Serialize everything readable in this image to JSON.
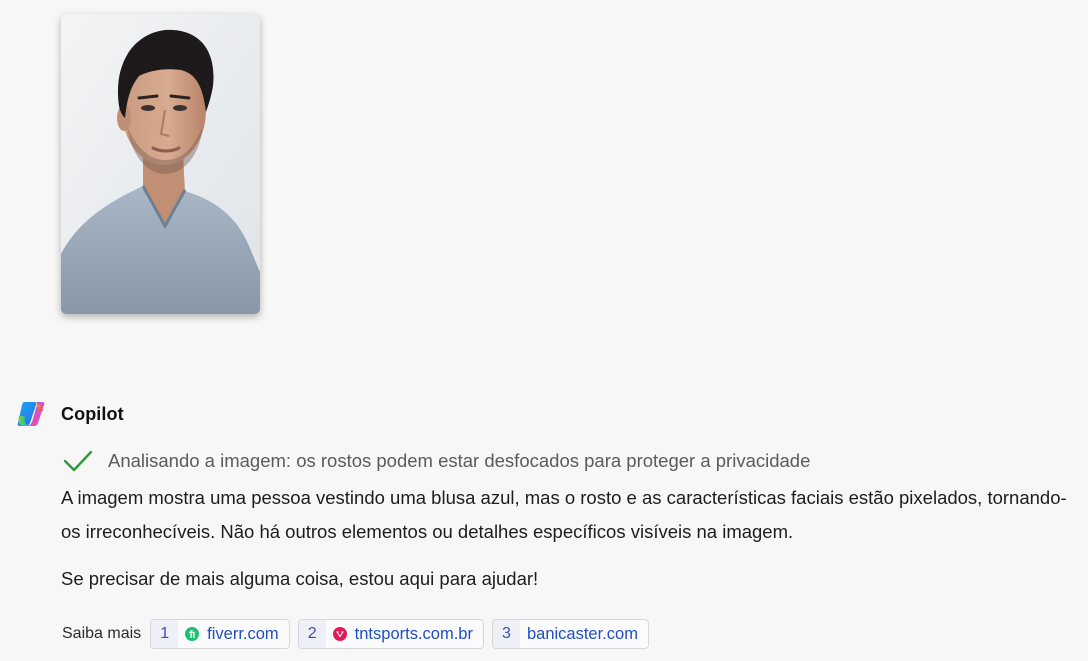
{
  "assistant": {
    "name": "Copilot"
  },
  "status": {
    "text": "Analisando a imagem: os rostos podem estar desfocados para proteger a privacidade"
  },
  "answer": {
    "paragraph_1": "A imagem mostra uma pessoa vestindo uma blusa azul, mas o rosto e as características faciais estão pixelados, tornando-os irreconhecíveis. Não há outros elementos ou detalhes específicos visíveis na imagem.",
    "paragraph_2": "Se precisar de mais alguma coisa, estou aqui para ajudar!"
  },
  "sources": {
    "label": "Saiba mais",
    "items": [
      {
        "number": "1",
        "domain": "fiverr.com",
        "icon": "fiverr-favicon",
        "color": "#1dbf73"
      },
      {
        "number": "2",
        "domain": "tntsports.com.br",
        "icon": "tntsports-favicon",
        "color": "#e0195a"
      },
      {
        "number": "3",
        "domain": "banicaster.com",
        "icon": "none"
      }
    ]
  },
  "colors": {
    "background": "#f7f7f7",
    "link": "#1f4fbf",
    "check": "#2e9b3c"
  }
}
